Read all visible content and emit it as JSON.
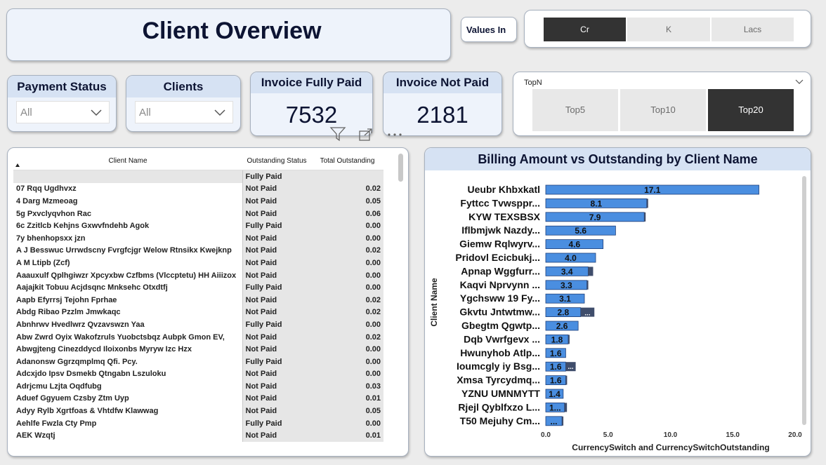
{
  "title": "Client Overview",
  "values_in": {
    "label": "Values In",
    "options": [
      "Cr",
      "K",
      "Lacs"
    ],
    "selected": "Cr"
  },
  "payment_status": {
    "label": "Payment Status",
    "value": "All"
  },
  "clients_slicer": {
    "label": "Clients",
    "value": "All"
  },
  "kpis": {
    "fully_paid": {
      "label": "Invoice Fully Paid",
      "value": "7532"
    },
    "not_paid": {
      "label": "Invoice Not Paid",
      "value": "2181"
    }
  },
  "topn": {
    "label": "TopN",
    "options": [
      "Top5",
      "Top10",
      "Top20"
    ],
    "selected": "Top20"
  },
  "table": {
    "columns": [
      "Client Name",
      "Outstanding Status",
      "Total Outstanding"
    ],
    "rows": [
      [
        "",
        "Fully Paid",
        ""
      ],
      [
        "07 Rqq Ugdhvxz",
        "Not Paid",
        "0.02"
      ],
      [
        "4 Darg Mzmeoag",
        "Not Paid",
        "0.05"
      ],
      [
        "5g Pxvclyqvhon Rac",
        "Not Paid",
        "0.06"
      ],
      [
        "6c Zzitlcb Kehjns Gxwvfndehb Agok",
        "Fully Paid",
        "0.00"
      ],
      [
        "7y bhenhopsxx jzn",
        "Not Paid",
        "0.00"
      ],
      [
        "A J Besswuc Urrwdscny Fvrgfcjgr Welow Rtnsikx Kwejknp",
        "Not Paid",
        "0.02"
      ],
      [
        "A M Ltipb (Zcf)",
        "Not Paid",
        "0.00"
      ],
      [
        "Aaauxulf Qplhgiwzr Xpcyxbw Czfbms (Vlccptetu) HH Aiiizox",
        "Not Paid",
        "0.00"
      ],
      [
        "Aajajkit Tobuu Acjdsqnc Mnksehc Otxdtfj",
        "Fully Paid",
        "0.00"
      ],
      [
        "Aapb Efyrrsj Tejohn Fprhae",
        "Not Paid",
        "0.02"
      ],
      [
        "Abdg Ribao Pzzlm Jmwkaqc",
        "Not Paid",
        "0.02"
      ],
      [
        "Abnhrwv Hvedlwrz Qvzavswzn Yaa",
        "Fully Paid",
        "0.00"
      ],
      [
        "Abw Zwrd Oyix Wakofzruls Yuobctsbqz Aubpk Gmon EV,",
        "Not Paid",
        "0.02"
      ],
      [
        "Abwgjteng Cinezddycd Iloixonbs Myryw Izc Hzx",
        "Not Paid",
        "0.00"
      ],
      [
        "Adanonsw Ggrzqmplmq Qfi. Pcy.",
        "Fully Paid",
        "0.00"
      ],
      [
        "Adcxjdo Ipsv Dsmekb Qtngabn Lszuloku",
        "Not Paid",
        "0.00"
      ],
      [
        "Adrjcmu Lzjta Oqdfubg",
        "Not Paid",
        "0.03"
      ],
      [
        "Aduef Ggyuem Czsby Ztm Uyp",
        "Not Paid",
        "0.01"
      ],
      [
        "Adyy Rylb Xgrtfoas & Vhtdfw Klawwag",
        "Not Paid",
        "0.05"
      ],
      [
        "Aehlfe Fwzla Cty Pmp",
        "Fully Paid",
        "0.00"
      ],
      [
        "AEK Wzqtj",
        "Not Paid",
        "0.01"
      ]
    ]
  },
  "chart_data": {
    "type": "bar",
    "title": "Billing Amount vs Outstanding by Client Name",
    "xlabel": "CurrencySwitch and CurrencySwitchOutstanding",
    "ylabel": "Client Name",
    "xlim": [
      0,
      20
    ],
    "xticks": [
      "0.0",
      "5.0",
      "10.0",
      "15.0",
      "20.0"
    ],
    "categories": [
      "Ueubr Khbxkatl",
      "Fyttcc Tvwsppr...",
      "KYW TEXSBSX",
      "Iflbmjwk Nazdy...",
      "Giemw Rqlwyrv...",
      "Pridovl Ecicbukj...",
      "Apnap Wggfurr...",
      "Kaqvi Nprvynn ...",
      "Ygchsww 19 Fy...",
      "Gkvtu Jntwtmw...",
      "Gbegtm Qgwtp...",
      "Dqb Vwrfgevx ...",
      "Hwunyhob Atlp...",
      "Ioumcgly iy Bsg...",
      "Xmsa Tyrcydmq...",
      "YZNU UMNMYTT",
      "Rjejl Qyblfxzo L...",
      "T50 Mejuhy Cm..."
    ],
    "series": [
      {
        "values": [
          17.1,
          8.1,
          7.9,
          5.6,
          4.6,
          4.0,
          3.4,
          3.3,
          3.1,
          2.8,
          2.6,
          1.8,
          1.6,
          1.6,
          1.6,
          1.4,
          1.5,
          1.3
        ]
      },
      {
        "values": [
          0.0,
          0.05,
          0.1,
          0.0,
          0.0,
          0.0,
          0.4,
          0.1,
          0.0,
          1.1,
          0.0,
          0.1,
          0.0,
          0.8,
          0.1,
          0.0,
          0.2,
          0.1
        ]
      }
    ],
    "data_labels": [
      "17.1",
      "8.1",
      "7.9",
      "5.6",
      "4.6",
      "4.0",
      "3.4",
      "3.3",
      "3.1",
      "2.8",
      "2.6",
      "1.8",
      "1.6",
      "1.6",
      "1.6",
      "1.4",
      "1...",
      "..."
    ],
    "overflow_label": "...",
    "colors": {
      "billing": "#4a8ee0",
      "outstanding": "#3f4d6b"
    }
  }
}
